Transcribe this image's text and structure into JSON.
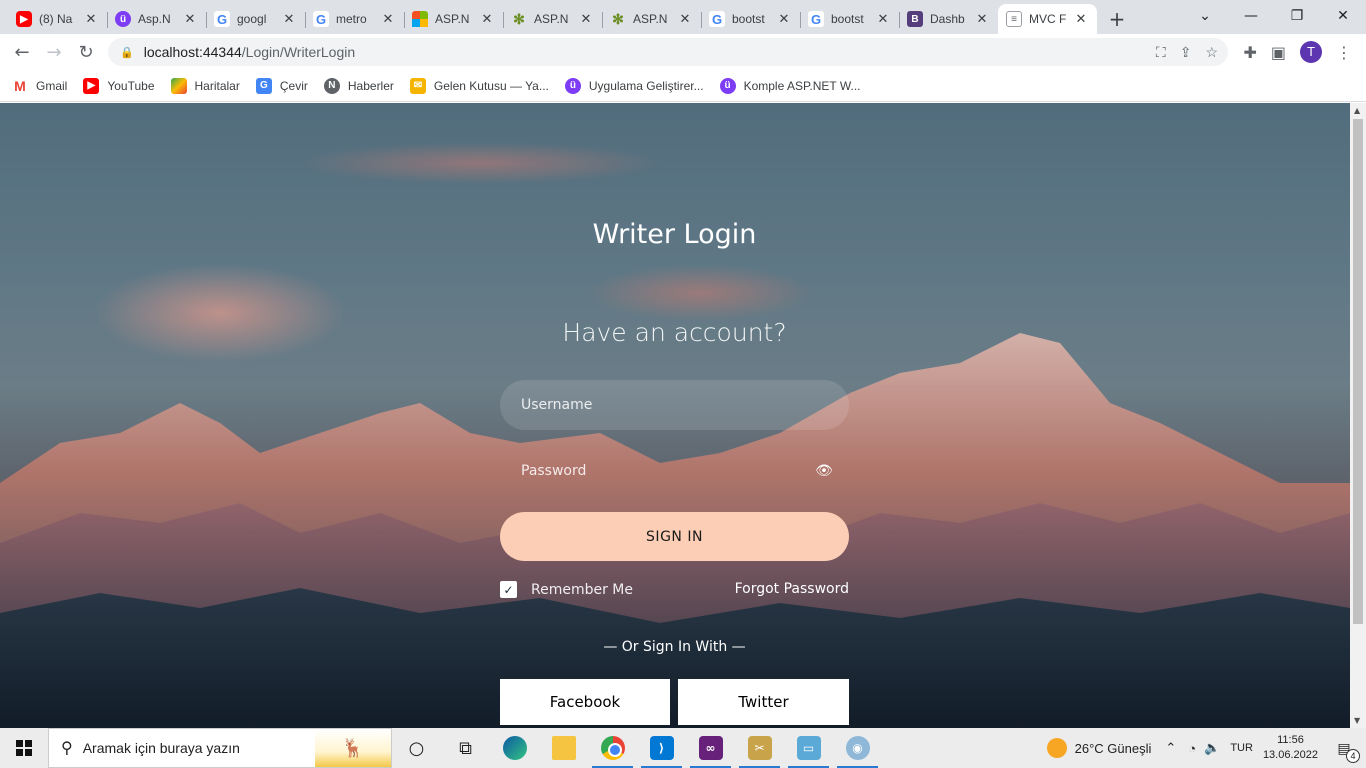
{
  "browser": {
    "tabs": [
      {
        "title": "(8) Na",
        "icon": "youtube-icon",
        "fav": "yt",
        "fav_text": "▶"
      },
      {
        "title": "Asp.N",
        "icon": "udemy-icon",
        "fav": "udemy",
        "fav_text": "ü"
      },
      {
        "title": "googl",
        "icon": "google-icon",
        "fav": "google",
        "fav_text": "G"
      },
      {
        "title": "metro",
        "icon": "google-icon",
        "fav": "google",
        "fav_text": "G"
      },
      {
        "title": "ASP.N",
        "icon": "microsoft-icon",
        "fav": "ms",
        "fav_text": ""
      },
      {
        "title": "ASP.N",
        "icon": "gear-icon",
        "fav": "gear",
        "fav_text": "✻"
      },
      {
        "title": "ASP.N",
        "icon": "gear-icon",
        "fav": "gear",
        "fav_text": "✻"
      },
      {
        "title": "bootst",
        "icon": "google-icon",
        "fav": "google",
        "fav_text": "G"
      },
      {
        "title": "bootst",
        "icon": "google-icon",
        "fav": "google",
        "fav_text": "G"
      },
      {
        "title": "Dashb",
        "icon": "bootstrap-icon",
        "fav": "bs",
        "fav_text": "B"
      },
      {
        "title": "MVC F",
        "icon": "document-icon",
        "fav": "doc",
        "fav_text": "≡",
        "active": true
      }
    ],
    "address": {
      "host": "localhost:44344",
      "path": "/Login/WriterLogin"
    },
    "profile_initial": "T",
    "bookmarks": [
      {
        "label": "Gmail",
        "icon": "gmail-icon",
        "cls": "gmail",
        "glyph": "M"
      },
      {
        "label": "YouTube",
        "icon": "youtube-icon",
        "cls": "yt",
        "glyph": "▶"
      },
      {
        "label": "Haritalar",
        "icon": "maps-icon",
        "cls": "maps",
        "glyph": ""
      },
      {
        "label": "Çevir",
        "icon": "translate-icon",
        "cls": "translate",
        "glyph": "G"
      },
      {
        "label": "Haberler",
        "icon": "news-icon",
        "cls": "news",
        "glyph": "N"
      },
      {
        "label": "Gelen Kutusu — Ya...",
        "icon": "inbox-icon",
        "cls": "inbox",
        "glyph": "✉"
      },
      {
        "label": "Uygulama Geliştirer...",
        "icon": "udemy-icon",
        "cls": "udemy",
        "glyph": "ü"
      },
      {
        "label": "Komple ASP.NET W...",
        "icon": "udemy-icon",
        "cls": "udemy",
        "glyph": "ü"
      }
    ]
  },
  "login": {
    "title": "Writer Login",
    "subtitle": "Have an account?",
    "username_placeholder": "Username",
    "password_placeholder": "Password",
    "sign_in_label": "SIGN IN",
    "remember_label": "Remember Me",
    "remember_checked": true,
    "forgot_label": "Forgot Password",
    "or_label": "— Or Sign In With —",
    "facebook_label": "Facebook",
    "twitter_label": "Twitter",
    "accent_color": "#fbceb5"
  },
  "taskbar": {
    "search_placeholder": "Aramak için buraya yazın",
    "weather": "26°C  Güneşli",
    "language": "TUR",
    "time": "11:56",
    "date": "13.06.2022",
    "notification_count": "4"
  }
}
